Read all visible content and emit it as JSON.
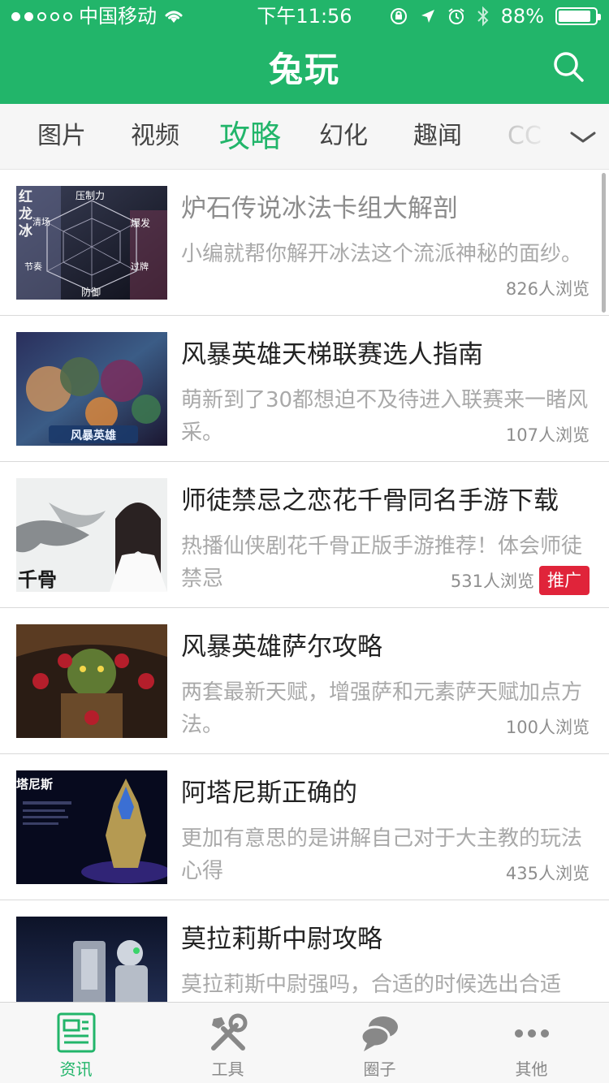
{
  "status_bar": {
    "carrier": "中国移动",
    "time": "下午11:56",
    "battery_percent": "88%",
    "battery_level": 0.88,
    "signal_bars_filled": 2,
    "signal_bars_total": 5
  },
  "header": {
    "title": "兔玩",
    "search_icon": "search-icon"
  },
  "tabs": {
    "items": [
      {
        "label": "图片",
        "active": false
      },
      {
        "label": "视频",
        "active": false
      },
      {
        "label": "攻略",
        "active": true
      },
      {
        "label": "幻化",
        "active": false
      },
      {
        "label": "趣闻",
        "active": false
      },
      {
        "label": "CC",
        "active": false
      }
    ],
    "more_icon": "chevron-down-icon"
  },
  "articles": [
    {
      "title": "炉石传说冰法卡组大解剖",
      "desc": "小编就帮你解开冰法这个流派神秘的面纱。",
      "views": "826人浏览",
      "read": true,
      "badge": "",
      "thumb_text": [
        "红",
        "龙",
        "冰",
        "压制力",
        "清场",
        "爆发",
        "节奏",
        "过牌",
        "防御"
      ]
    },
    {
      "title": "风暴英雄天梯联赛选人指南",
      "desc": "萌新到了30都想迫不及待进入联赛来一睹风采。",
      "views": "107人浏览",
      "read": false,
      "badge": "",
      "thumb_text": [
        "风暴英雄"
      ]
    },
    {
      "title": "师徒禁忌之恋花千骨同名手游下载",
      "desc": "热播仙侠剧花千骨正版手游推荐！体会师徒禁忌",
      "views": "531人浏览",
      "read": false,
      "badge": "推广",
      "thumb_text": [
        "千骨"
      ]
    },
    {
      "title": "风暴英雄萨尔攻略",
      "desc": "两套最新天赋，增强萨和元素萨天赋加点方法。",
      "views": "100人浏览",
      "read": false,
      "badge": "",
      "thumb_text": []
    },
    {
      "title": "阿塔尼斯正确的",
      "desc": "更加有意思的是讲解自己对于大主教的玩法心得",
      "views": "435人浏览",
      "read": false,
      "badge": "",
      "thumb_text": [
        "塔尼斯"
      ]
    },
    {
      "title": "莫拉莉斯中尉攻略",
      "desc": "莫拉莉斯中尉强吗，合适的时候选出合适",
      "views": "",
      "read": false,
      "badge": "",
      "thumb_text": []
    }
  ],
  "bottom_tabs": [
    {
      "label": "资讯",
      "icon": "news-icon",
      "active": true
    },
    {
      "label": "工具",
      "icon": "tools-icon",
      "active": false
    },
    {
      "label": "圈子",
      "icon": "chat-bubbles-icon",
      "active": false
    },
    {
      "label": "其他",
      "icon": "more-dots-icon",
      "active": false
    }
  ],
  "colors": {
    "brand_green": "#22b56a",
    "promo_red": "#e0243a"
  }
}
